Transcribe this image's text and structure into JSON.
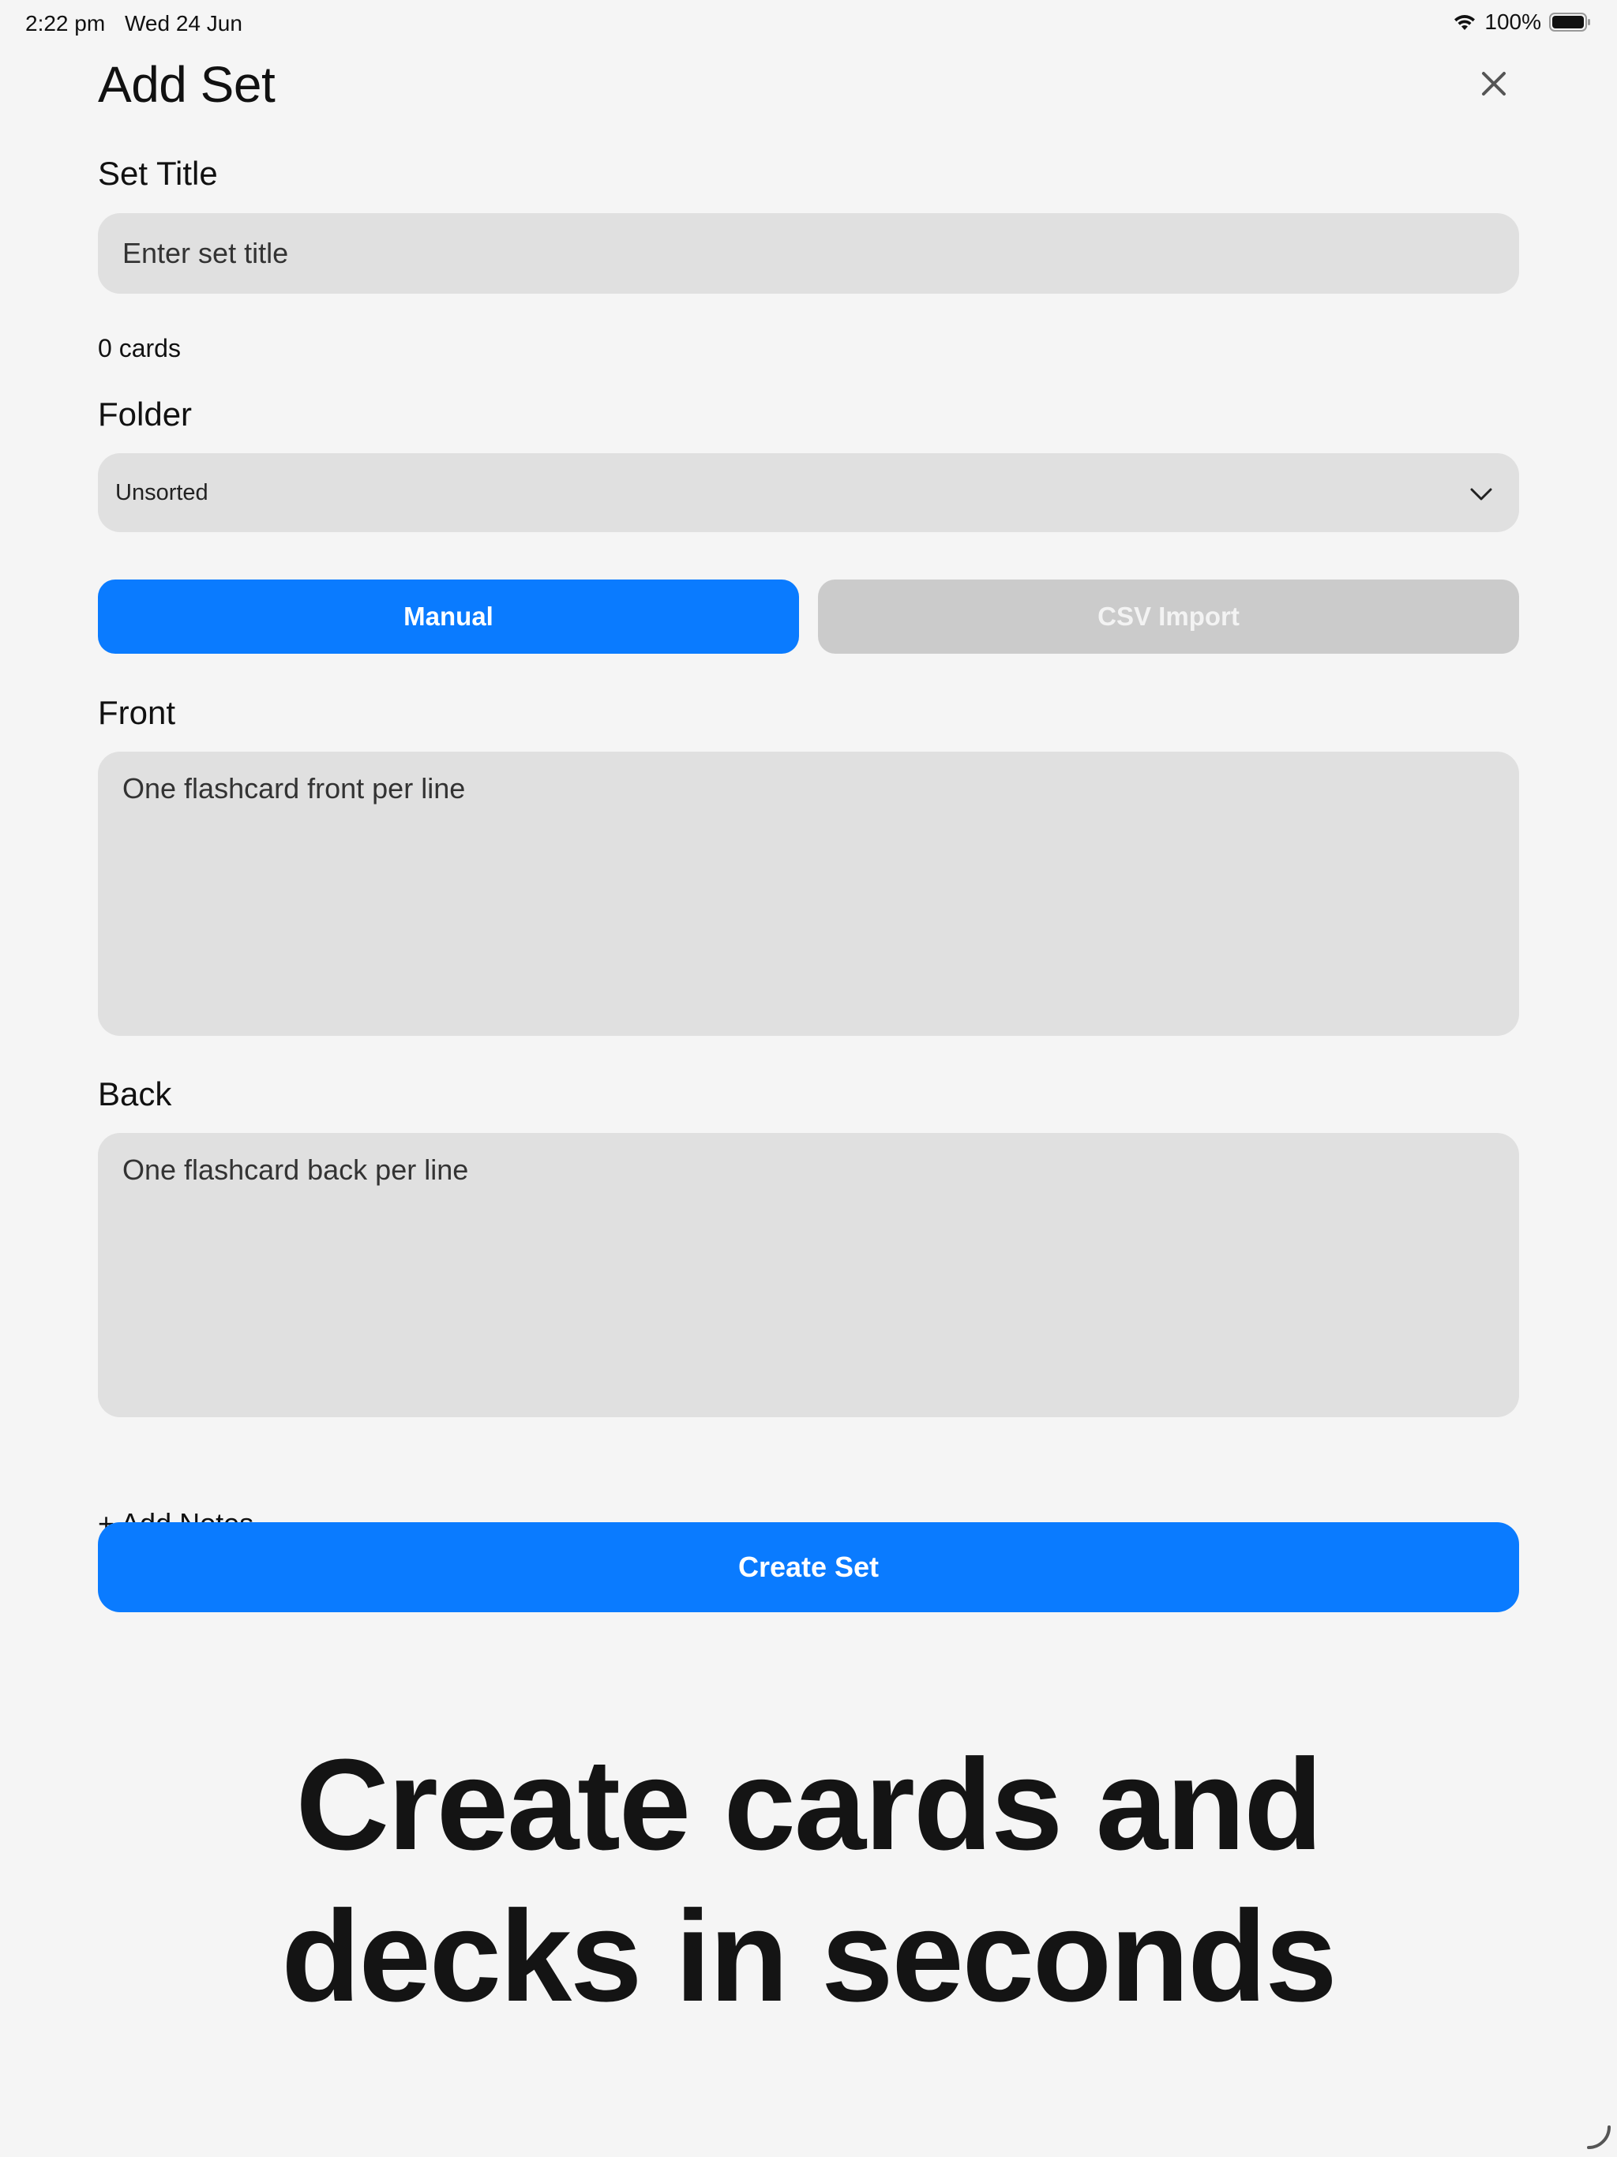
{
  "status_bar": {
    "time": "2:22 pm",
    "date": "Wed 24 Jun",
    "battery": "100%",
    "icons": [
      "wifi-icon",
      "battery-icon"
    ]
  },
  "sheet": {
    "title": "Add Set",
    "close_icon": "close-icon",
    "set_title": {
      "label": "Set Title",
      "placeholder": "Enter set title",
      "value": ""
    },
    "card_count": "0 cards",
    "folder": {
      "label": "Folder",
      "selected": "Unsorted",
      "icon": "chevron-down-icon"
    },
    "modes": {
      "manual_label": "Manual",
      "csv_label": "CSV Import",
      "active": "Manual"
    },
    "front": {
      "label": "Front",
      "placeholder": "One flashcard front per line",
      "value": ""
    },
    "back": {
      "label": "Back",
      "placeholder": "One flashcard back per line",
      "value": ""
    },
    "add_notes_label": "+ Add Notes",
    "create_button_label": "Create Set"
  },
  "tagline": {
    "line1": "Create cards and",
    "line2": "decks in seconds"
  },
  "colors": {
    "accent": "#0a7bff",
    "background": "#f5f5f5",
    "field": "#e0e0e0",
    "inactive_button": "#cbcbcb"
  }
}
